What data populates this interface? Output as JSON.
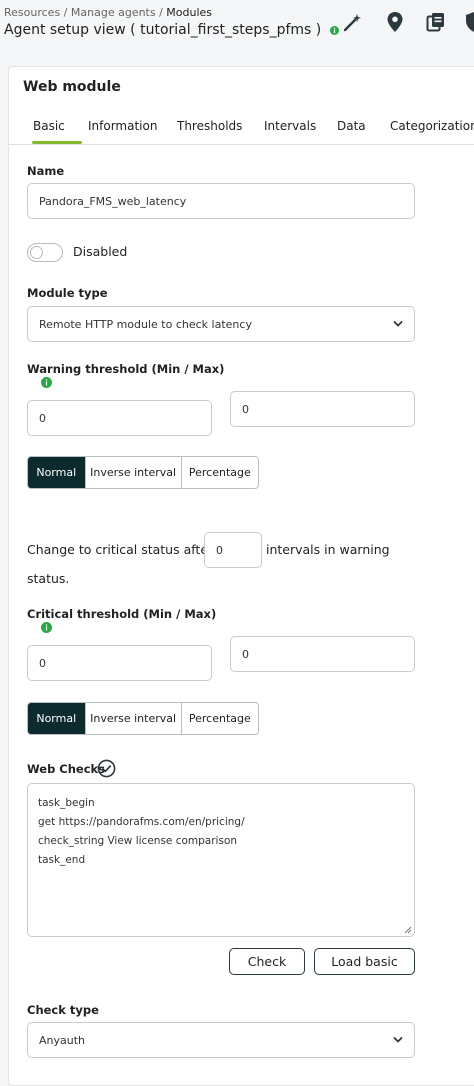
{
  "header": {
    "breadcrumb": {
      "item1": "Resources",
      "sep1": " / ",
      "item2": "Manage agents",
      "sep2": " / ",
      "current": "Modules"
    },
    "title": "Agent setup view ( tutorial_first_steps_pfms )",
    "status_color": "#2aa745",
    "icons": [
      "wand-icon",
      "location-pin-icon",
      "copy-icon",
      "shield-icon"
    ]
  },
  "panel": {
    "title": "Web module",
    "tabs": [
      "Basic",
      "Information",
      "Thresholds",
      "Intervals",
      "Data",
      "Categorization"
    ],
    "active_tab": "Basic",
    "accent_color": "#82b92e"
  },
  "form": {
    "name_label": "Name",
    "name_value": "Pandora_FMS_web_latency",
    "disabled_label": "Disabled",
    "module_type_label": "Module type",
    "module_type_value": "Remote HTTP module to check latency",
    "warning_label": "Warning threshold (Min / Max)",
    "warning_min": "0",
    "warning_max": "0",
    "warning_mode": {
      "options": [
        "Normal",
        "Inverse interval",
        "Percentage"
      ],
      "selected": "Normal"
    },
    "critical_change_prefix": "Change to critical status after",
    "critical_change_value": "0",
    "critical_change_suffix_1": "intervals in warning",
    "critical_change_suffix_2": "status.",
    "critical_label": "Critical threshold (Min / Max)",
    "critical_min": "0",
    "critical_max": "0",
    "critical_mode": {
      "options": [
        "Normal",
        "Inverse interval",
        "Percentage"
      ],
      "selected": "Normal"
    },
    "web_checks_label": "Web Checks",
    "web_checks_lines": [
      "task_begin",
      "get https://pandorafms.com/en/pricing/",
      "check_string View license comparison",
      "task_end"
    ],
    "check_button": "Check",
    "load_basic_button": "Load basic",
    "check_type_label": "Check type",
    "check_type_value": "Anyauth"
  }
}
